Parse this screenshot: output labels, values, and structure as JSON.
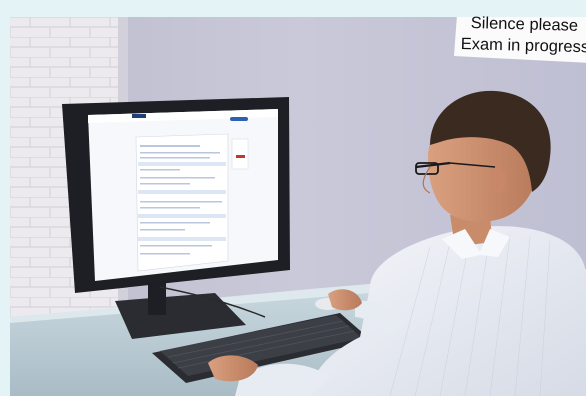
{
  "sign": {
    "line1": "Silence please",
    "line2": "Exam in progress"
  },
  "monitor_screen": {
    "description_hidden": true
  },
  "colors": {
    "frame_border": "#e3f3f6",
    "wall": "#c8c7d8",
    "desk": "#b7c9d1",
    "shirt": "#eef2f7",
    "monitor": "#1d1f24"
  }
}
